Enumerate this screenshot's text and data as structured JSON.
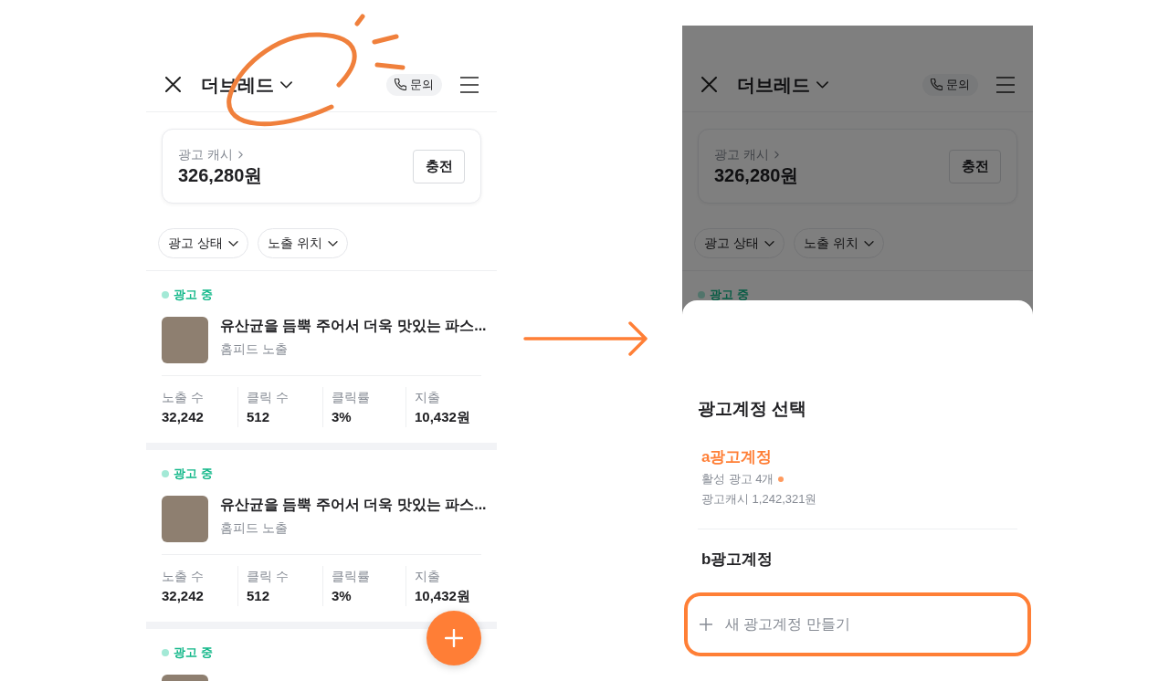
{
  "before_screen": {
    "header": {
      "title": "더브레드",
      "contact_button": "문의"
    },
    "cash_card": {
      "label": "광고 캐시",
      "amount": "326,280원",
      "charge_button": "충전"
    },
    "filters": [
      "광고 상태",
      "노출 위치"
    ],
    "ads": [
      {
        "status": {
          "label": "광고 중",
          "kind": "active"
        },
        "photo": true,
        "title": "유산균을 듬뿍 주어서 더욱 맛있는 파스...",
        "placement": "홈피드 노출",
        "stats": [
          {
            "label": "노출 수",
            "value": "32,242"
          },
          {
            "label": "클릭 수",
            "value": "512"
          },
          {
            "label": "클릭률",
            "value": "3%"
          },
          {
            "label": "지출",
            "value": "10,432원"
          }
        ]
      },
      {
        "status": {
          "label": "광고 중",
          "kind": "active"
        },
        "photo": true,
        "title": "유산균을 듬뿍 주어서 더욱 맛있는 파스...",
        "placement": "홈피드 노출",
        "stats": [
          {
            "label": "노출 수",
            "value": "32,242"
          },
          {
            "label": "클릭 수",
            "value": "512"
          },
          {
            "label": "클릭률",
            "value": "3%"
          },
          {
            "label": "지출",
            "value": "10,432원"
          }
        ]
      },
      {
        "status": {
          "label": "광고 중",
          "kind": "active"
        },
        "photo": true
      }
    ]
  },
  "after_screen": {
    "header": {
      "title": "더브레드",
      "contact_button": "문의"
    },
    "cash_card": {
      "label": "광고 캐시",
      "amount": "326,280원",
      "charge_button": "충전"
    },
    "filters": [
      "광고 상태",
      "노출 위치"
    ],
    "ads": [
      {
        "status": {
          "label": "광고 중",
          "kind": "active"
        }
      }
    ],
    "account_sheet": {
      "title": "광고계정 선택",
      "accounts": [
        {
          "name": "a광고계정",
          "selected": true,
          "active_ads": "활성 광고 4개",
          "cash": "광고캐시 1,242,321원"
        },
        {
          "name": "b광고계정",
          "selected": false
        }
      ],
      "new_account_button": "새 광고계정 만들기"
    }
  }
}
